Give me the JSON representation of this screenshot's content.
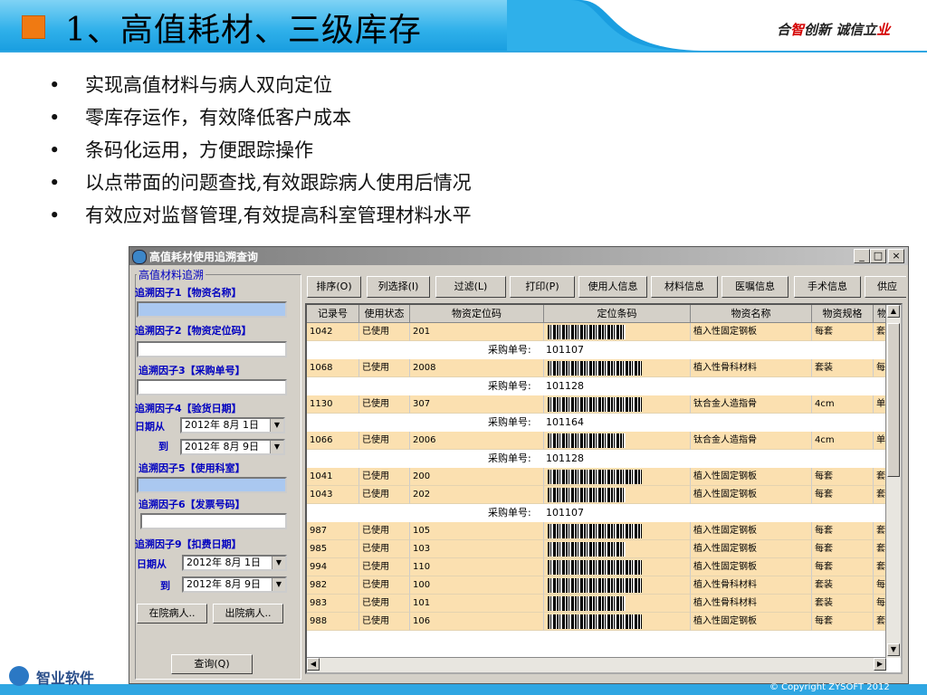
{
  "slide": {
    "title": "1、高值耗材、三级库存",
    "slogan_a": "合",
    "slogan_b": "智",
    "slogan_c": "创新 诚信立",
    "slogan_d": "业",
    "bullets": [
      "实现高值材料与病人双向定位",
      "零库存运作，有效降低客户成本",
      "条码化运用，方便跟踪操作",
      "以点带面的问题查找,有效跟踪病人使用后情况",
      "有效应对监督管理,有效提高科室管理材料水平"
    ],
    "bullet_mark": "•",
    "logo_text": "智业软件",
    "copyright": "© Copyright ZYSOFT 2012"
  },
  "window": {
    "title": "高值耗材使用追溯查询",
    "minimize": "_",
    "maximize": "□",
    "close": "×"
  },
  "filter": {
    "group_title": "高值材料追溯",
    "factor1": "追溯因子1【物资名称】",
    "factor2": "追溯因子2【物资定位码】",
    "factor3": "追溯因子3【采购单号】",
    "factor4": "追溯因子4【验货日期】",
    "date_from_label": "日期从",
    "date_to_label": "到",
    "date4_from": "2012年 8月 1日",
    "date4_to": "2012年 8月 9日",
    "factor5": "追溯因子5【使用科室】",
    "factor6": "追溯因子6【发票号码】",
    "factor9": "追溯因子9【扣费日期】",
    "date9_from": "2012年 8月 1日",
    "date9_to": "2012年 8月 9日",
    "inpatient_btn": "在院病人..",
    "discharged_btn": "出院病人..",
    "query_btn": "查询(Q)"
  },
  "toolbar": {
    "buttons": [
      "排序(O)",
      "列选择(I)",
      "过滤(L)",
      "打印(P)",
      "使用人信息",
      "材料信息",
      "医嘱信息",
      "手术信息",
      "供应"
    ]
  },
  "grid": {
    "headers": [
      "记录号",
      "使用状态",
      "物资定位码",
      "定位条码",
      "物资名称",
      "物资规格",
      "物"
    ],
    "purchase_label": "采购单号:",
    "rows": [
      {
        "type": "main",
        "id": "1042",
        "status": "已使用",
        "loc": "201",
        "name": "植入性固定钢板",
        "spec": "每套",
        "unit": "套"
      },
      {
        "type": "sub",
        "po": "101107"
      },
      {
        "type": "main",
        "id": "1068",
        "status": "已使用",
        "loc": "2008",
        "name": "植入性骨科材料",
        "spec": "套装",
        "unit": "每"
      },
      {
        "type": "sub",
        "po": "101128"
      },
      {
        "type": "main",
        "id": "1130",
        "status": "已使用",
        "loc": "307",
        "name": "钛合金人造指骨",
        "spec": "4cm",
        "unit": "单"
      },
      {
        "type": "sub",
        "po": "101164"
      },
      {
        "type": "main",
        "id": "1066",
        "status": "已使用",
        "loc": "2006",
        "name": "钛合金人造指骨",
        "spec": "4cm",
        "unit": "单"
      },
      {
        "type": "sub",
        "po": "101128"
      },
      {
        "type": "main",
        "id": "1041",
        "status": "已使用",
        "loc": "200",
        "name": "植入性固定钢板",
        "spec": "每套",
        "unit": "套"
      },
      {
        "type": "main",
        "id": "1043",
        "status": "已使用",
        "loc": "202",
        "name": "植入性固定钢板",
        "spec": "每套",
        "unit": "套"
      },
      {
        "type": "sub",
        "po": "101107"
      },
      {
        "type": "main",
        "id": "987",
        "status": "已使用",
        "loc": "105",
        "name": "植入性固定钢板",
        "spec": "每套",
        "unit": "套"
      },
      {
        "type": "main",
        "id": "985",
        "status": "已使用",
        "loc": "103",
        "name": "植入性固定钢板",
        "spec": "每套",
        "unit": "套"
      },
      {
        "type": "main",
        "id": "994",
        "status": "已使用",
        "loc": "110",
        "name": "植入性固定钢板",
        "spec": "每套",
        "unit": "套"
      },
      {
        "type": "main",
        "id": "982",
        "status": "已使用",
        "loc": "100",
        "name": "植入性骨科材料",
        "spec": "套装",
        "unit": "每"
      },
      {
        "type": "main",
        "id": "983",
        "status": "已使用",
        "loc": "101",
        "name": "植入性骨科材料",
        "spec": "套装",
        "unit": "每"
      },
      {
        "type": "main",
        "id": "988",
        "status": "已使用",
        "loc": "106",
        "name": "植入性固定钢板",
        "spec": "每套",
        "unit": "套"
      }
    ]
  }
}
